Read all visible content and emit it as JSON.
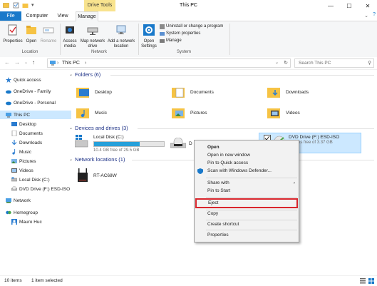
{
  "window": {
    "title": "This PC",
    "drive_tools_label": "Drive Tools",
    "buttons": {
      "minimize": "—",
      "maximize": "☐",
      "close": "✕"
    }
  },
  "tabs": {
    "file": "File",
    "computer": "Computer",
    "view": "View",
    "manage": "Manage"
  },
  "ribbon": {
    "location": {
      "label": "Location",
      "properties": "Properties",
      "open": "Open",
      "rename": "Rename"
    },
    "network": {
      "label": "Network",
      "access_media": "Access media",
      "map_network_drive": "Map network drive",
      "add_network_location": "Add a network location"
    },
    "system": {
      "label": "System",
      "open_settings": "Open Settings",
      "uninstall": "Uninstall or change a program",
      "system_properties": "System properties",
      "manage": "Manage"
    }
  },
  "address": {
    "path": "This PC",
    "search_placeholder": "Search This PC"
  },
  "nav": {
    "quick_access": "Quick access",
    "onedrive_family": "OneDrive - Family",
    "onedrive_personal": "OneDrive - Personal",
    "this_pc": "This PC",
    "desktop": "Desktop",
    "documents": "Documents",
    "downloads": "Downloads",
    "music": "Music",
    "pictures": "Pictures",
    "videos": "Videos",
    "local_disk": "Local Disk (C:)",
    "dvd_drive": "DVD Drive (F:) ESD-ISO",
    "network": "Network",
    "homegroup": "Homegroup",
    "user": "Mauro Huc"
  },
  "folders": {
    "header": "Folders (6)",
    "items": [
      "Desktop",
      "Documents",
      "Downloads",
      "Music",
      "Pictures",
      "Videos"
    ]
  },
  "drives": {
    "header": "Devices and drives (3)",
    "local": {
      "name": "Local Disk (C:)",
      "free": "10.4 GB free of 29.5 GB",
      "used_fraction": 0.65
    },
    "dvd_partial": "D",
    "iso": {
      "name": "DVD Drive (F:) ESD-ISO",
      "free": "0 bytes free of 3.37 GB"
    }
  },
  "network_locations": {
    "header": "Network locations (1)",
    "items": [
      "RT-AC68W"
    ]
  },
  "context_menu": {
    "open": "Open",
    "open_new_window": "Open in new window",
    "pin_quick_access": "Pin to Quick access",
    "scan_defender": "Scan with Windows Defender...",
    "share_with": "Share with",
    "pin_start": "Pin to Start",
    "eject": "Eject",
    "copy": "Copy",
    "create_shortcut": "Create shortcut",
    "properties": "Properties"
  },
  "status": {
    "items": "10 items",
    "selected": "1 item selected"
  },
  "colors": {
    "accent": "#1979ca",
    "highlight": "#cce8ff",
    "drive_tools": "#f8e38e",
    "eject_outline": "#d9262d"
  }
}
